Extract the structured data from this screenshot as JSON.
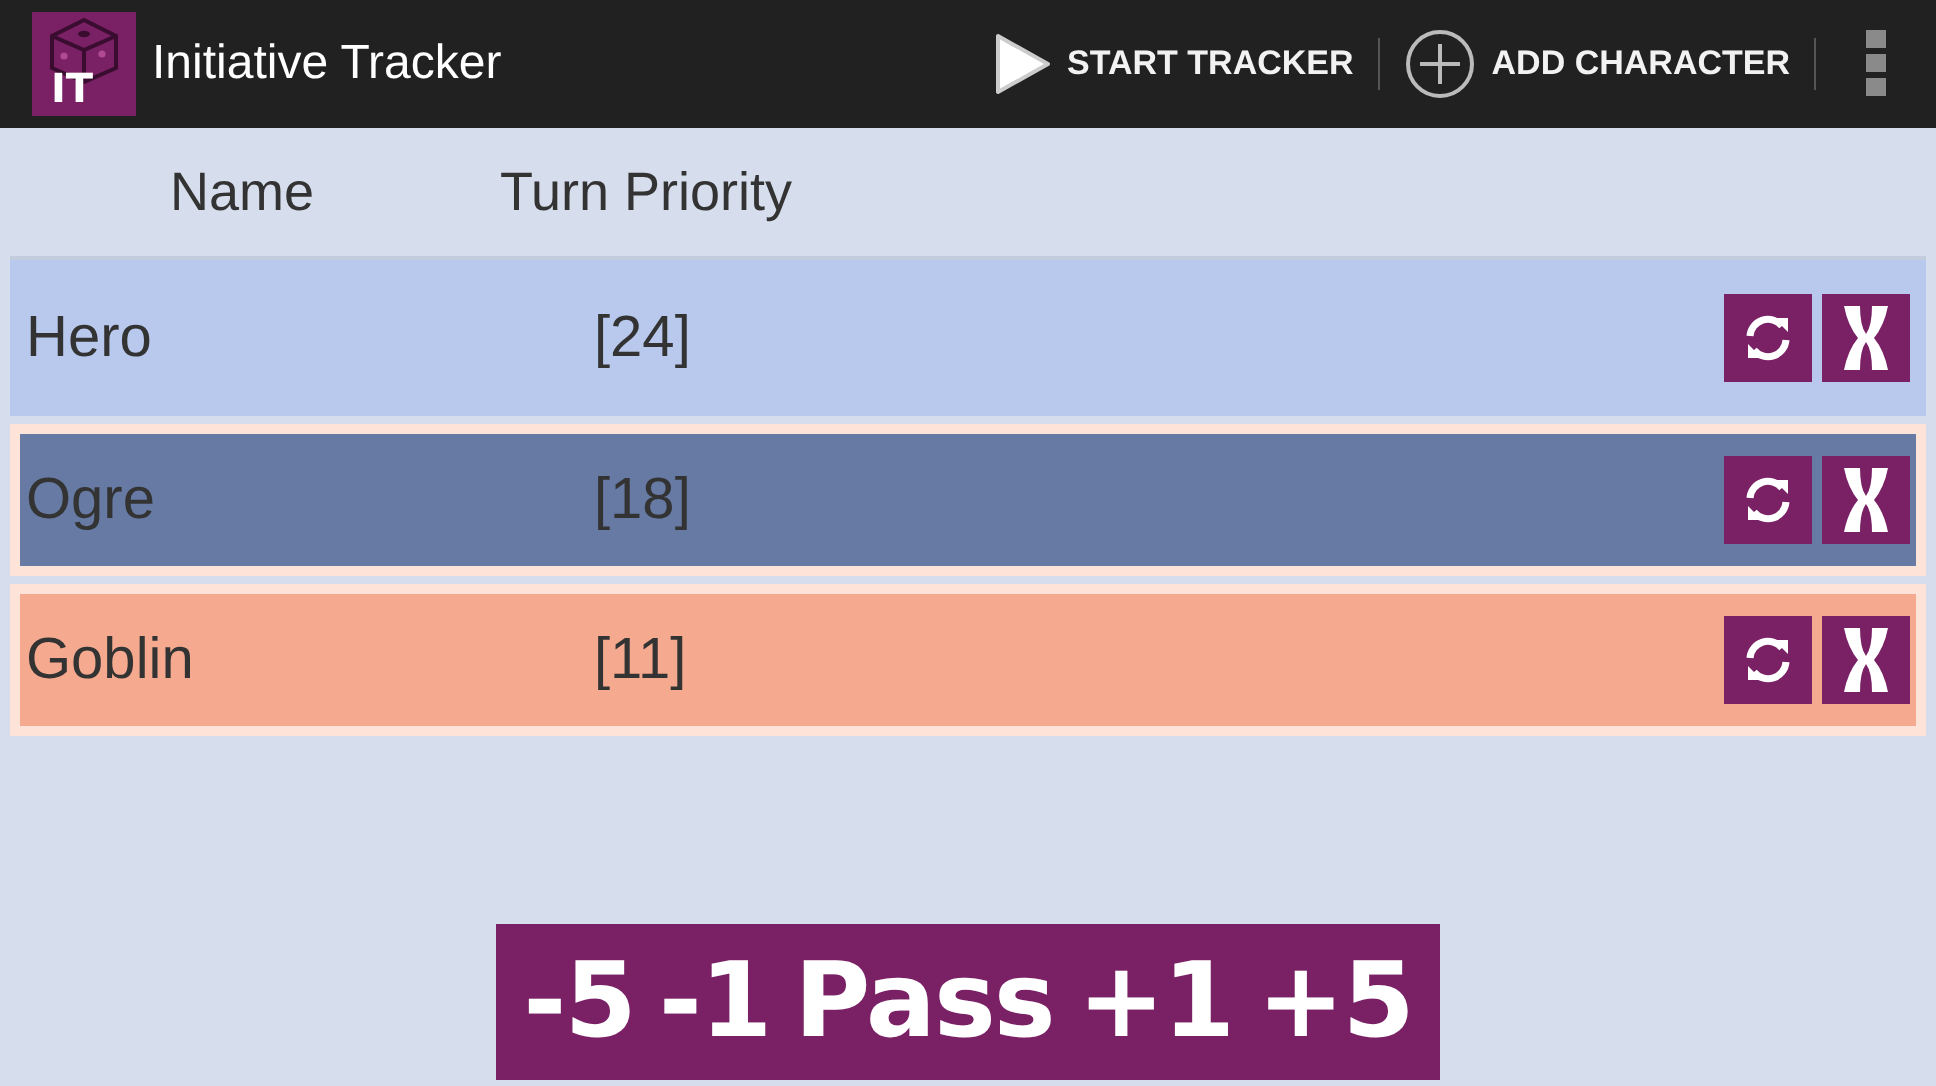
{
  "action_bar": {
    "logo_text": "IT",
    "title": "Initiative Tracker",
    "actions": [
      {
        "kind": "play",
        "label": "START TRACKER"
      },
      {
        "kind": "add",
        "label": "ADD CHARACTER"
      }
    ]
  },
  "columns": [
    "Name",
    "Turn Priority"
  ],
  "characters": [
    {
      "name": "Hero",
      "priority": "[24]",
      "color": "#b8c9ed",
      "current": true
    },
    {
      "name": "Ogre",
      "priority": "[18]",
      "color": "#667aa4",
      "current": false
    },
    {
      "name": "Goblin",
      "priority": "[11]",
      "color": "#f5aa8f",
      "current": false
    }
  ],
  "adjust_buttons": [
    "-5",
    "-1",
    "Pass",
    "+1",
    "+5"
  ]
}
